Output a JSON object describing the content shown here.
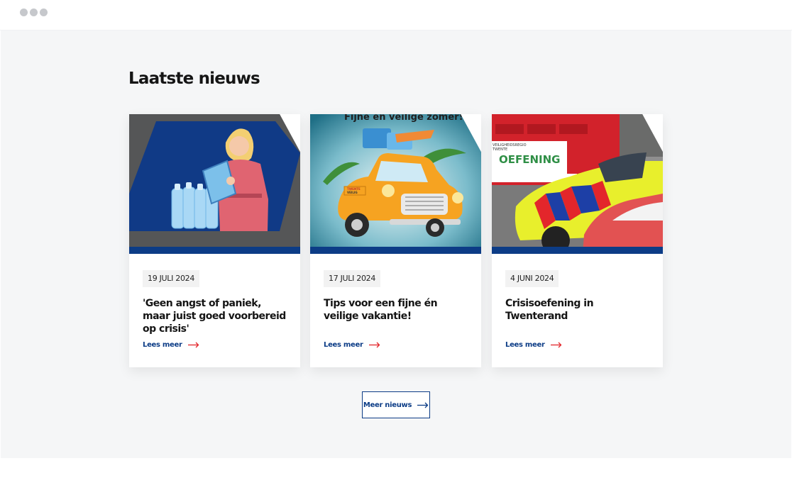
{
  "section": {
    "heading": "Laatste nieuws"
  },
  "news": [
    {
      "date": "19 JULI 2024",
      "title": "'Geen angst of paniek, maar juist goed voorbereid op crisis'",
      "link_label": "Lees meer"
    },
    {
      "date": "17 JULI 2024",
      "title": "Tips voor een fijne én veilige vakantie!",
      "link_label": "Lees meer",
      "image_text": "Fijne en veilige zomer!",
      "plate_text_top": "TWENTE",
      "plate_text_bottom": "VEILIG"
    },
    {
      "date": "4 JUNI 2024",
      "title": "Crisisoefening in Twenterand",
      "link_label": "Lees meer",
      "banner_small_1": "VEILIGHEIDSREGIO",
      "banner_small_2": "TWENTE",
      "banner_text": "OEFENING"
    }
  ],
  "more_button": {
    "label": "Meer nieuws"
  },
  "colors": {
    "brand_blue": "#0c3c86",
    "accent_red": "#e3262b",
    "section_bg": "#f5f6f7"
  },
  "icons": [
    "arrow-right-icon"
  ]
}
